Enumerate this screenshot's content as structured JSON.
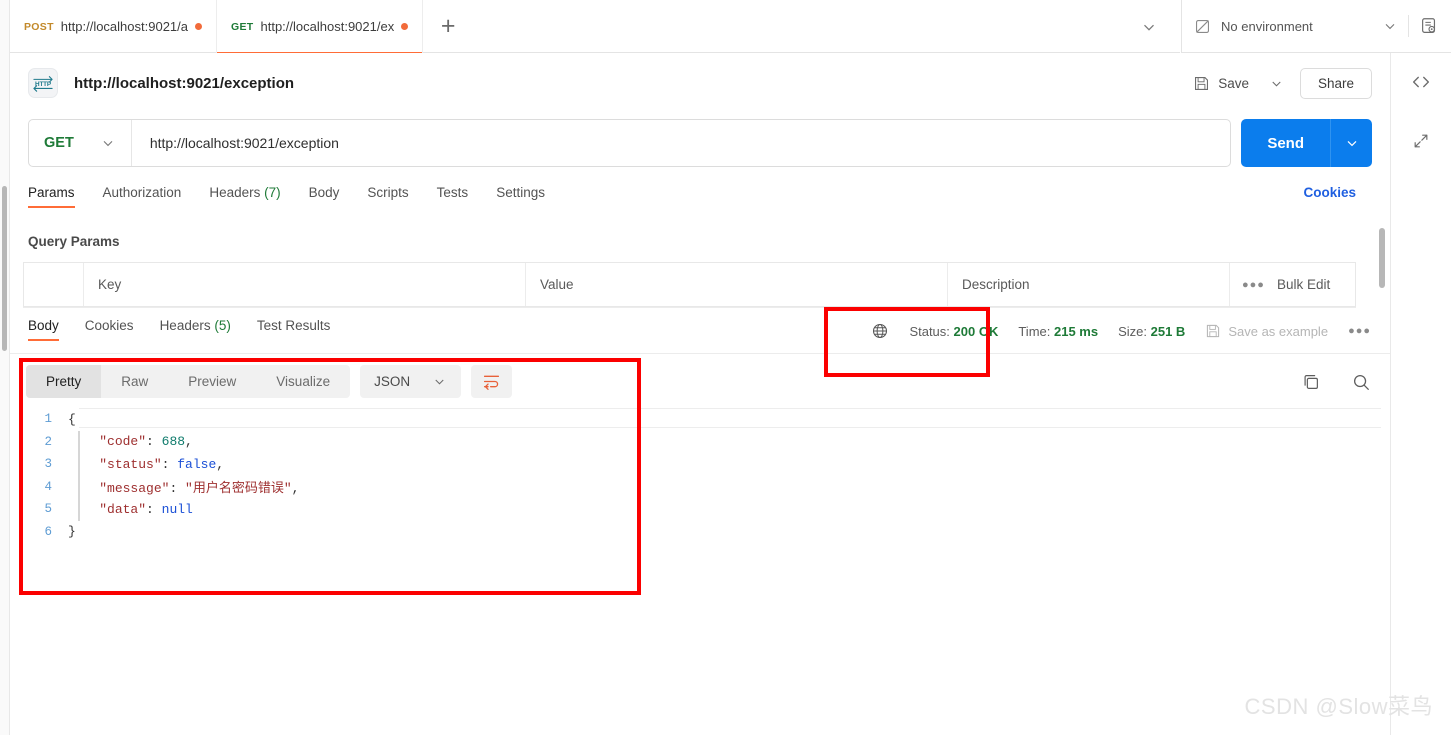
{
  "window": {
    "request_tabs": [
      {
        "method": "POST",
        "title": "http://localhost:9021/a",
        "unsaved": true,
        "active": false
      },
      {
        "method": "GET",
        "title": "http://localhost:9021/ex",
        "unsaved": true,
        "active": true
      }
    ],
    "new_tab_label": "+",
    "environment": {
      "label": "No environment"
    }
  },
  "request": {
    "icon_text": "HTTP",
    "title": "http://localhost:9021/exception",
    "save_label": "Save",
    "share_label": "Share",
    "method": "GET",
    "url": "http://localhost:9021/exception",
    "send_label": "Send",
    "tabs": [
      {
        "label": "Params",
        "count": "",
        "active": true
      },
      {
        "label": "Authorization",
        "count": "",
        "active": false
      },
      {
        "label": "Headers",
        "count": "(7)",
        "active": false
      },
      {
        "label": "Body",
        "count": "",
        "active": false
      },
      {
        "label": "Scripts",
        "count": "",
        "active": false
      },
      {
        "label": "Tests",
        "count": "",
        "active": false
      },
      {
        "label": "Settings",
        "count": "",
        "active": false
      }
    ],
    "cookies_link": "Cookies",
    "query_params": {
      "section_title": "Query Params",
      "columns": [
        "Key",
        "Value",
        "Description"
      ],
      "bulk_edit_label": "Bulk Edit",
      "rows": []
    }
  },
  "response": {
    "tabs": [
      {
        "label": "Body",
        "count": "",
        "active": true
      },
      {
        "label": "Cookies",
        "count": "",
        "active": false
      },
      {
        "label": "Headers",
        "count": "(5)",
        "active": false
      },
      {
        "label": "Test Results",
        "count": "",
        "active": false
      }
    ],
    "status_label": "Status:",
    "status_value": "200 OK",
    "time_label": "Time:",
    "time_value": "215 ms",
    "size_label": "Size:",
    "size_value": "251 B",
    "save_example_label": "Save as example",
    "format_tabs": [
      {
        "label": "Pretty",
        "active": true
      },
      {
        "label": "Raw",
        "active": false
      },
      {
        "label": "Preview",
        "active": false
      },
      {
        "label": "Visualize",
        "active": false
      }
    ],
    "language": "JSON",
    "body_lines": [
      {
        "n": "1",
        "segments": [
          {
            "t": "{",
            "c": "tok-punc"
          }
        ]
      },
      {
        "n": "2",
        "segments": [
          {
            "t": "    ",
            "c": "tok-punc"
          },
          {
            "t": "\"code\"",
            "c": "tok-key"
          },
          {
            "t": ": ",
            "c": "tok-punc"
          },
          {
            "t": "688",
            "c": "tok-num"
          },
          {
            "t": ",",
            "c": "tok-punc"
          }
        ]
      },
      {
        "n": "3",
        "segments": [
          {
            "t": "    ",
            "c": "tok-punc"
          },
          {
            "t": "\"status\"",
            "c": "tok-key"
          },
          {
            "t": ": ",
            "c": "tok-punc"
          },
          {
            "t": "false",
            "c": "tok-bool"
          },
          {
            "t": ",",
            "c": "tok-punc"
          }
        ]
      },
      {
        "n": "4",
        "segments": [
          {
            "t": "    ",
            "c": "tok-punc"
          },
          {
            "t": "\"message\"",
            "c": "tok-key"
          },
          {
            "t": ": ",
            "c": "tok-punc"
          },
          {
            "t": "\"用户名密码错误\"",
            "c": "tok-str"
          },
          {
            "t": ",",
            "c": "tok-punc"
          }
        ]
      },
      {
        "n": "5",
        "segments": [
          {
            "t": "    ",
            "c": "tok-punc"
          },
          {
            "t": "\"data\"",
            "c": "tok-key"
          },
          {
            "t": ": ",
            "c": "tok-punc"
          },
          {
            "t": "null",
            "c": "tok-bool"
          }
        ]
      },
      {
        "n": "6",
        "segments": [
          {
            "t": "}",
            "c": "tok-punc"
          }
        ]
      }
    ],
    "body_json": {
      "code": 688,
      "status": false,
      "message": "用户名密码错误",
      "data": null
    }
  },
  "annotations": {
    "highlight_color": "#fb0000",
    "boxes": [
      "response-status",
      "response-body"
    ]
  },
  "watermark": "CSDN @Slow菜鸟",
  "colors": {
    "accent_orange": "#ff6c37",
    "send_blue": "#0b7ded",
    "link_blue": "#1f5fe0",
    "success_green": "#1e7a37",
    "annotation_red": "#fb0000"
  }
}
